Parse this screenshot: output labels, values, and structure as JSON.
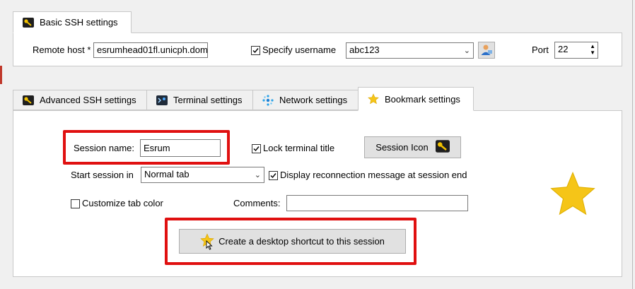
{
  "tabs_top": {
    "basic_ssh": {
      "label": "Basic SSH settings",
      "icon": "key-icon"
    }
  },
  "basic": {
    "remote_host_label": "Remote host *",
    "remote_host_value": "esrumhead01fl.unicph.dom",
    "specify_username_label": "Specify username",
    "specify_username_checked": true,
    "username_value": "abc123",
    "user_manager_icon": "user-icon",
    "port_label": "Port",
    "port_value": "22"
  },
  "tabs_bottom": {
    "advanced_ssh": {
      "label": "Advanced SSH settings",
      "icon": "key-icon"
    },
    "terminal": {
      "label": "Terminal settings",
      "icon": "terminal-icon"
    },
    "network": {
      "label": "Network settings",
      "icon": "network-icon"
    },
    "bookmark": {
      "label": "Bookmark settings",
      "icon": "star-icon"
    }
  },
  "bookmark": {
    "session_name_label": "Session name:",
    "session_name_value": "Esrum",
    "lock_terminal_title_label": "Lock terminal title",
    "lock_terminal_title_checked": true,
    "session_icon_label": "Session Icon",
    "start_session_label": "Start session in",
    "start_session_value": "Normal tab",
    "display_reconnection_label": "Display reconnection message at session end",
    "display_reconnection_checked": true,
    "customize_tab_color_label": "Customize tab color",
    "customize_tab_color_checked": false,
    "comments_label": "Comments:",
    "comments_value": "",
    "shortcut_button_label": "Create a desktop shortcut to this session",
    "big_star_icon": "star-icon"
  },
  "colors": {
    "highlight_red": "#e01010",
    "star_gold": "#f5c518",
    "key_bg": "#1f1f1f"
  }
}
